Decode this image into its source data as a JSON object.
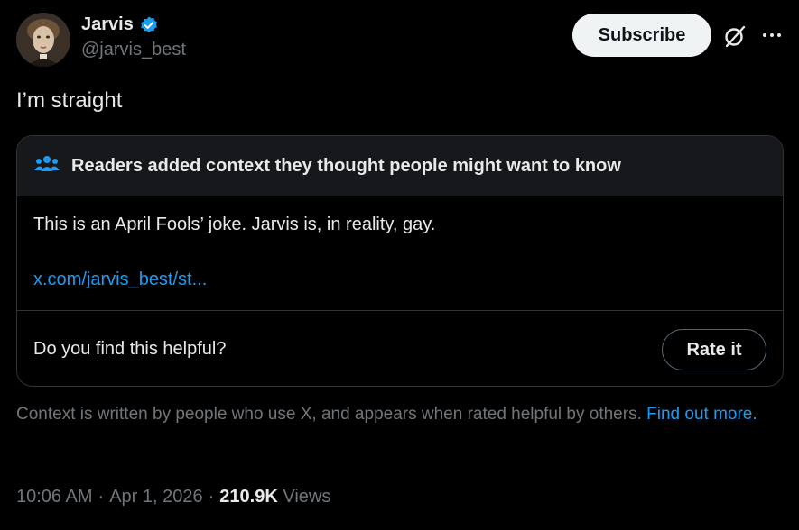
{
  "author": {
    "name": "Jarvis",
    "handle": "@jarvis_best",
    "avatar_alt": "profile portrait"
  },
  "actions": {
    "subscribe_label": "Subscribe",
    "grok_icon": "grok-icon",
    "more_icon": "more-icon"
  },
  "tweet": {
    "text": "I’m straight"
  },
  "community_note": {
    "title": "Readers added context they thought people might want to know",
    "body": "This is an April Fools’ joke. Jarvis is, in reality, gay.",
    "link": "x.com/jarvis_best/st...",
    "helpful_prompt": "Do you find this helpful?",
    "rate_label": "Rate it"
  },
  "context_info": {
    "text": "Context is written by people who use X, and appears when rated helpful by others.",
    "link_text": "Find out more."
  },
  "meta": {
    "time": "10:06 AM",
    "sep1": "·",
    "date": "Apr 1, 2026",
    "sep2": "·",
    "views_count": "210.9K",
    "views_label": "Views"
  },
  "colors": {
    "background": "#000000",
    "accent": "#1d9bf0",
    "text_primary": "#e7e9ea",
    "text_secondary": "#71767b",
    "border": "#2f3336"
  }
}
